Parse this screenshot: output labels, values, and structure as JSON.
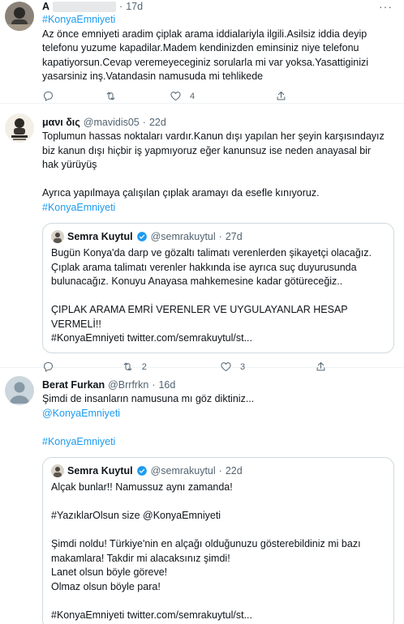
{
  "tweets": [
    {
      "name": "A",
      "time": "17d",
      "lines": [
        "#KonyaEmniyeti",
        "Az önce emniyeti aradim çiplak arama iddialariyla ilgili.Asilsiz iddia deyip",
        "telefonu yuzume kapadilar.Madem kendinizden eminsiniz niye telefonu",
        "kapatiyorsun.Cevap veremeyeceginiz sorularla mi var yoksa.Yasattiginizi",
        "yasarsiniz inş.Vatandasin namusuda mi tehlikede"
      ],
      "likes": "4"
    },
    {
      "name": "μανι δις",
      "handle": "@mavidis05",
      "time": "22d",
      "lines": [
        "Toplumun hassas noktaları vardır.Kanun dışı yapılan her şeyin karşısındayız",
        "biz kanun dışı hiçbir iş yapmıyoruz eğer kanunsuz  ise neden anayasal bir",
        "hak yürüyüş",
        "",
        "Ayrıca yapılmaya çalışılan çıplak aramayı da esefle kınıyoruz.",
        "#KonyaEmniyeti"
      ],
      "quote": {
        "name": "Semra Kuytul",
        "handle": "@semrakuytul",
        "time": "27d",
        "lines": [
          "Bugün Konya'da darp ve gözaltı talimatı verenlerden şikayetçi olacağız.",
          "Çıplak arama talimatı verenler hakkında ise ayrıca suç duyurusunda",
          "bulunacağız. Konuyu Anayasa mahkemesine kadar götüreceğiz..",
          "",
          "ÇIPLAK ARAMA EMRİ VERENLER VE UYGULAYANLAR HESAP",
          "VERMELİ!!",
          "#KonyaEmniyeti twitter.com/semrakuytul/st..."
        ]
      },
      "retweets": "2",
      "likes": "3"
    },
    {
      "name": "Berat Furkan",
      "handle": "@Brrfrkn",
      "time": "16d",
      "lines": [
        "Şimdi de insanların namusuna mı göz diktiniz...",
        "@KonyaEmniyeti",
        "",
        "#KonyaEmniyeti"
      ],
      "quote": {
        "name": "Semra Kuytul",
        "handle": "@semrakuytul",
        "time": "22d",
        "lines": [
          "Alçak bunlar!! Namussuz aynı zamanda!",
          "",
          "#YazıklarOlsun size @KonyaEmniyeti",
          "",
          "Şimdi noldu! Türkiye'nin en alçağı olduğunuzu gösterebildiniz mi bazı",
          "makamlara! Takdir mi alacaksınız şimdi!",
          "Lanet olsun böyle göreve!",
          "Olmaz olsun böyle para!",
          "",
          "#KonyaEmniyeti twitter.com/semrakuytul/st..."
        ]
      }
    }
  ],
  "sep": "·",
  "more": "···",
  "colors": {
    "link": "#1d9bf0",
    "muted": "#536471",
    "border": "#cfd9de"
  },
  "icons": [
    "reply-icon",
    "retweet-icon",
    "like-icon",
    "share-icon",
    "verified-icon",
    "more-icon"
  ]
}
